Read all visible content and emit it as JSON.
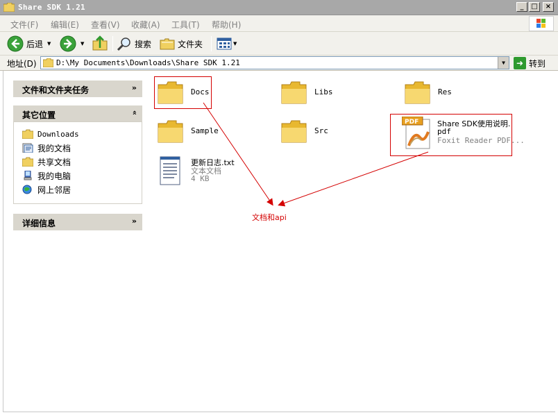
{
  "window": {
    "title": "Share SDK 1.21"
  },
  "menu": [
    {
      "label": "文件(F)"
    },
    {
      "label": "编辑(E)"
    },
    {
      "label": "查看(V)"
    },
    {
      "label": "收藏(A)"
    },
    {
      "label": "工具(T)"
    },
    {
      "label": "帮助(H)"
    }
  ],
  "toolbar": {
    "back_label": "后退",
    "search_label": "搜索",
    "folders_label": "文件夹"
  },
  "address": {
    "label": "地址(D)",
    "value": "D:\\My Documents\\Downloads\\Share SDK 1.21",
    "go_label": "转到"
  },
  "sidebar": {
    "tasks_title": "文件和文件夹任务",
    "places_title": "其它位置",
    "places": [
      {
        "label": "Downloads",
        "icon": "folder-icon"
      },
      {
        "label": "我的文档",
        "icon": "my-documents-icon"
      },
      {
        "label": "共享文档",
        "icon": "folder-icon"
      },
      {
        "label": "我的电脑",
        "icon": "my-computer-icon"
      },
      {
        "label": "网上邻居",
        "icon": "network-icon"
      }
    ],
    "details_title": "详细信息"
  },
  "files": [
    {
      "name": "Docs",
      "type": "folder"
    },
    {
      "name": "Libs",
      "type": "folder"
    },
    {
      "name": "Res",
      "type": "folder"
    },
    {
      "name": "Sample",
      "type": "folder"
    },
    {
      "name": "Src",
      "type": "folder"
    },
    {
      "name": "Share SDK使用说明.",
      "name2": "pdf",
      "desc": "Foxit Reader PDF...",
      "type": "pdf"
    },
    {
      "name": "更新日志.txt",
      "desc": "文本文档",
      "size": "4 KB",
      "type": "text"
    }
  ],
  "annotation": {
    "text": "文档和api",
    "color": "#d40000"
  }
}
